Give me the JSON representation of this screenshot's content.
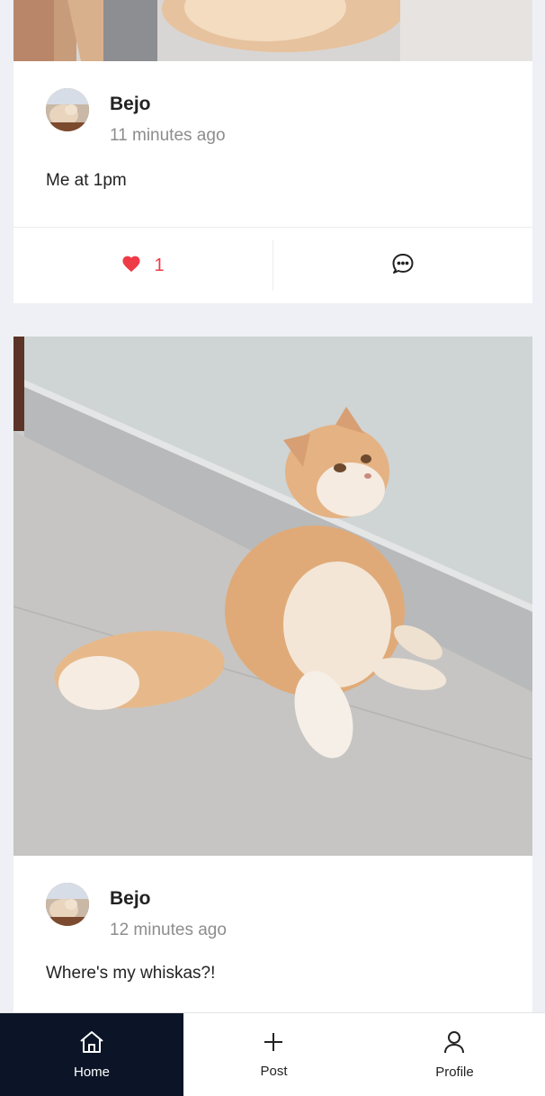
{
  "posts": [
    {
      "author": "Bejo",
      "timestamp": "11 minutes ago",
      "text": "Me at 1pm",
      "likes": "1"
    },
    {
      "author": "Bejo",
      "timestamp": "12 minutes ago",
      "text": "Where's my whiskas?!"
    }
  ],
  "nav": {
    "home": "Home",
    "post": "Post",
    "profile": "Profile"
  },
  "colors": {
    "like": "#ef3b47",
    "nav_active_bg": "#0b1527"
  },
  "icons": [
    "heart-icon",
    "comment-icon",
    "home-icon",
    "plus-icon",
    "user-icon"
  ]
}
